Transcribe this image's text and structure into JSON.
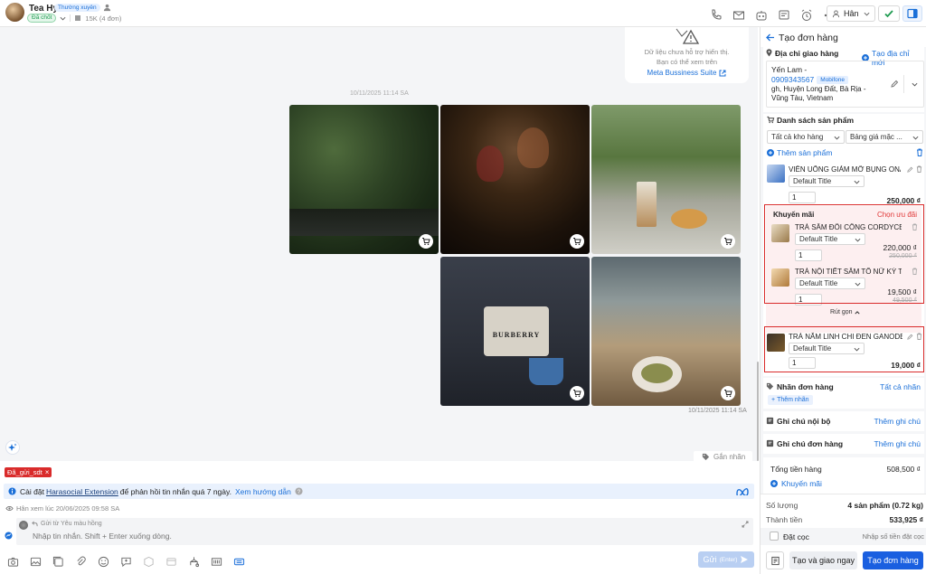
{
  "header": {
    "name": "Tea Hy",
    "tier_badge": "Thường xuyên",
    "status_badge": "Đã chốt",
    "order_info": "15K (4 đơn)",
    "assignee": "Hân"
  },
  "chat": {
    "meta_notice_line1": "Dữ liệu chưa hỗ trợ hiển thị.",
    "meta_notice_line2": "Bạn có thể xem trên",
    "meta_link": "Meta Bussiness Suite",
    "date_top": "10/11/2025 11:14 SA",
    "date_bottom": "10/11/2025 11:14 SA",
    "photo_brand": "BURBERRY",
    "tag_button": "Gắn nhãn"
  },
  "composer": {
    "tag_chip": "Đã_gửi_sdt",
    "info_prefix": "Cài đặt",
    "info_link": "Harasocial Extension",
    "info_middle": "để phản hồi tin nhắn quá 7 ngày.",
    "info_guide": "Xem hướng dẫn",
    "seen_text": "Hân xem lúc 20/06/2025 09:58 SA",
    "reply_from": "Gửi từ Yêu màu hồng",
    "placeholder": "Nhập tin nhắn. Shift + Enter xuống dòng.",
    "send_label": "Gửi",
    "send_hint": "(Enter)"
  },
  "panel": {
    "title": "Tạo đơn hàng",
    "address_section": "Địa chỉ giao hàng",
    "add_address": "Tạo địa chỉ mới",
    "customer_name": "Yến Lam -",
    "customer_phone": "0909343567",
    "carrier_badge": "Mobifone",
    "address_line1": "gh, Huyện Long Đất, Bà Rịa -",
    "address_line2": "Vũng Tàu, Vietnam",
    "products_section": "Danh sách sản phẩm",
    "warehouse_select": "Tất cả kho hàng",
    "pricelist_select": "Bảng giá mặc ...",
    "add_product": "Thêm sản phẩm",
    "product1": {
      "name": "VIÊN UỐNG GIẢM MỠ BỤNG ONA...",
      "variant": "Default Title",
      "qty": "1",
      "price": "250,000 ₫"
    },
    "promo_title": "Khuyến mãi",
    "promo_choose": "Chọn ưu đãi",
    "promo1": {
      "name": "TRÀ SÂM ĐÔI CÔNG CORDYCEPS ...",
      "variant": "Default Title",
      "qty": "1",
      "price": "220,000 ₫",
      "old_price": "250,000 ₫"
    },
    "promo2": {
      "name": "TRÀ NỘI TIẾT SÂM TỐ NỮ KỲ TỬ",
      "variant": "Default Title",
      "qty": "1",
      "price": "19,500 ₫",
      "old_price": "49,500 ₫"
    },
    "collapse": "Rút gọn",
    "product2": {
      "name": "TRÀ NẤM LINH CHI ĐEN GANODE...",
      "variant": "Default Title",
      "qty": "1",
      "price": "19,000 ₫"
    },
    "order_tag_label": "Nhãn đơn hàng",
    "all_tags": "Tất cả nhãn",
    "add_tag": "Thêm nhãn",
    "internal_note": "Ghi chú nội bộ",
    "order_note": "Ghi chú đơn hàng",
    "add_note": "Thêm ghi chú",
    "subtotal_label": "Tổng tiền hàng",
    "subtotal_value": "508,500 ₫",
    "promo_link": "Khuyến mãi",
    "quantity_label": "Số lượng",
    "quantity_value": "4 sản phẩm (0.72 kg)",
    "total_label": "Thành tiền",
    "total_value": "533,925 ₫",
    "deposit_label": "Đặt cọc",
    "deposit_placeholder": "Nhập số tiền đặt cọc",
    "create_ship_button": "Tạo và giao ngay",
    "create_button": "Tạo đơn hàng"
  },
  "colors": {
    "accent": "#1a6fd8",
    "danger": "#d92b2b",
    "promo_bg": "#fdeff0",
    "success": "#1e9b50"
  }
}
